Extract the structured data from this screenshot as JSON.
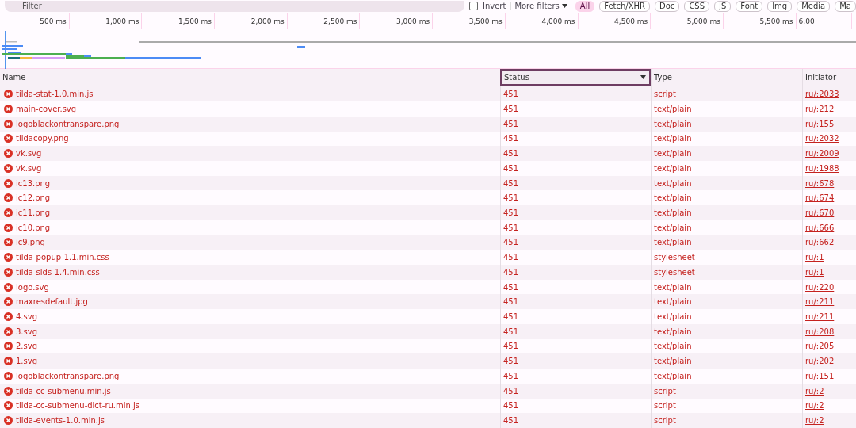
{
  "toolbar": {
    "filter": {
      "placeholder": "Filter"
    },
    "invert": {
      "label": "Invert",
      "checked": false
    },
    "more_filters": "More filters",
    "types": [
      {
        "label": "All",
        "selected": true
      },
      {
        "label": "Fetch/XHR",
        "selected": false
      },
      {
        "label": "Doc",
        "selected": false
      },
      {
        "label": "CSS",
        "selected": false
      },
      {
        "label": "JS",
        "selected": false
      },
      {
        "label": "Font",
        "selected": false
      },
      {
        "label": "Img",
        "selected": false
      },
      {
        "label": "Media",
        "selected": false
      },
      {
        "label": "Ma",
        "selected": false
      }
    ]
  },
  "timeline": {
    "ticks": [
      "500 ms",
      "1,000 ms",
      "1,500 ms",
      "2,000 ms",
      "2,500 ms",
      "3,000 ms",
      "3,500 ms",
      "4,000 ms",
      "4,500 ms",
      "5,000 ms",
      "5,500 ms",
      "6,00"
    ]
  },
  "table": {
    "columns": [
      {
        "label": "Name",
        "selected": false
      },
      {
        "label": "Status",
        "selected": true
      },
      {
        "label": "Type",
        "selected": false
      },
      {
        "label": "Initiator",
        "selected": false
      }
    ],
    "rows": [
      {
        "name": "tilda-stat-1.0.min.js",
        "status": "451",
        "type": "script",
        "initiator": "ru/:2033"
      },
      {
        "name": "main-cover.svg",
        "status": "451",
        "type": "text/plain",
        "initiator": "ru/:212"
      },
      {
        "name": "logoblackontranspare.png",
        "status": "451",
        "type": "text/plain",
        "initiator": "ru/:155"
      },
      {
        "name": "tildacopy.png",
        "status": "451",
        "type": "text/plain",
        "initiator": "ru/:2032"
      },
      {
        "name": "vk.svg",
        "status": "451",
        "type": "text/plain",
        "initiator": "ru/:2009"
      },
      {
        "name": "vk.svg",
        "status": "451",
        "type": "text/plain",
        "initiator": "ru/:1988"
      },
      {
        "name": "ic13.png",
        "status": "451",
        "type": "text/plain",
        "initiator": "ru/:678"
      },
      {
        "name": "ic12.png",
        "status": "451",
        "type": "text/plain",
        "initiator": "ru/:674"
      },
      {
        "name": "ic11.png",
        "status": "451",
        "type": "text/plain",
        "initiator": "ru/:670"
      },
      {
        "name": "ic10.png",
        "status": "451",
        "type": "text/plain",
        "initiator": "ru/:666"
      },
      {
        "name": "ic9.png",
        "status": "451",
        "type": "text/plain",
        "initiator": "ru/:662"
      },
      {
        "name": "tilda-popup-1.1.min.css",
        "status": "451",
        "type": "stylesheet",
        "initiator": "ru/:1"
      },
      {
        "name": "tilda-slds-1.4.min.css",
        "status": "451",
        "type": "stylesheet",
        "initiator": "ru/:1"
      },
      {
        "name": "logo.svg",
        "status": "451",
        "type": "text/plain",
        "initiator": "ru/:220"
      },
      {
        "name": "maxresdefault.jpg",
        "status": "451",
        "type": "text/plain",
        "initiator": "ru/:211"
      },
      {
        "name": "4.svg",
        "status": "451",
        "type": "text/plain",
        "initiator": "ru/:211"
      },
      {
        "name": "3.svg",
        "status": "451",
        "type": "text/plain",
        "initiator": "ru/:208"
      },
      {
        "name": "2.svg",
        "status": "451",
        "type": "text/plain",
        "initiator": "ru/:205"
      },
      {
        "name": "1.svg",
        "status": "451",
        "type": "text/plain",
        "initiator": "ru/:202"
      },
      {
        "name": "logoblackontranspare.png",
        "status": "451",
        "type": "text/plain",
        "initiator": "ru/:151"
      },
      {
        "name": "tilda-cc-submenu.min.js",
        "status": "451",
        "type": "script",
        "initiator": "ru/:2"
      },
      {
        "name": "tilda-cc-submenu-dict-ru.min.js",
        "status": "451",
        "type": "script",
        "initiator": "ru/:2"
      },
      {
        "name": "tilda-events-1.0.min.js",
        "status": "451",
        "type": "script",
        "initiator": "ru/:2"
      }
    ]
  }
}
